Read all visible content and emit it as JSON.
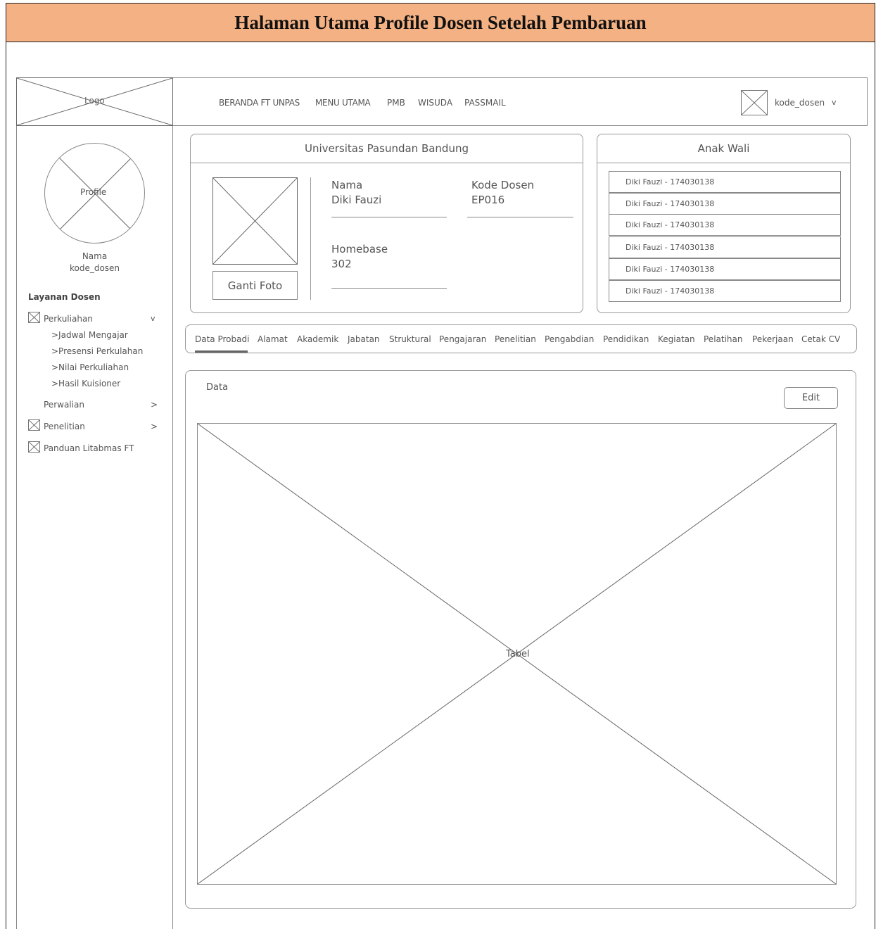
{
  "page_title": "Halaman Utama Profile Dosen Setelah Pembaruan",
  "header": {
    "logo_label": "Logo",
    "nav": [
      "BERANDA FT UNPAS",
      "MENU UTAMA",
      "PMB",
      "WISUDA",
      "PASSMAIL"
    ],
    "user_label": "kode_dosen",
    "user_caret": "v"
  },
  "sidebar": {
    "profile_label": "Profile",
    "name": "Nama",
    "code": "kode_dosen",
    "section_title": "Layanan Dosen",
    "perkuliahan": {
      "label": "Perkuliahan",
      "caret": "v"
    },
    "sub_items": [
      ">Jadwal Mengajar",
      ">Presensi Perkulahan",
      ">Nilai Perkuliahan",
      ">Hasil Kuisioner"
    ],
    "perwalian": {
      "label": "Perwalian",
      "caret": ">"
    },
    "penelitian": {
      "label": "Penelitian",
      "caret": ">"
    },
    "panduan": {
      "label": "Panduan Litabmas FT"
    }
  },
  "profile_card": {
    "title": "Universitas Pasundan  Bandung",
    "photo_button": "Ganti Foto",
    "nama_label": "Nama",
    "nama_value": "Diki Fauzi",
    "kode_label": "Kode Dosen",
    "kode_value": "EP016",
    "homebase_label": "Homebase",
    "homebase_value": "302"
  },
  "wali_card": {
    "title": "Anak Wali",
    "items": [
      "Diki Fauzi - 174030138",
      "Diki Fauzi - 174030138",
      "Diki Fauzi - 174030138",
      "Diki Fauzi - 174030138",
      "Diki Fauzi - 174030138",
      "Diki Fauzi - 174030138"
    ]
  },
  "tabs": [
    "Data Probadi",
    "Alamat",
    "Akademik",
    "Jabatan",
    "Struktural",
    "Pengajaran",
    "Penelitian",
    "Pengabdian",
    "Pendidikan",
    "Kegiatan",
    "Pelatihan",
    "Pekerjaan",
    "Cetak CV"
  ],
  "active_tab": "Data Probadi",
  "data_panel": {
    "title": "Data",
    "edit_button": "Edit",
    "table_label": "Tabel"
  }
}
